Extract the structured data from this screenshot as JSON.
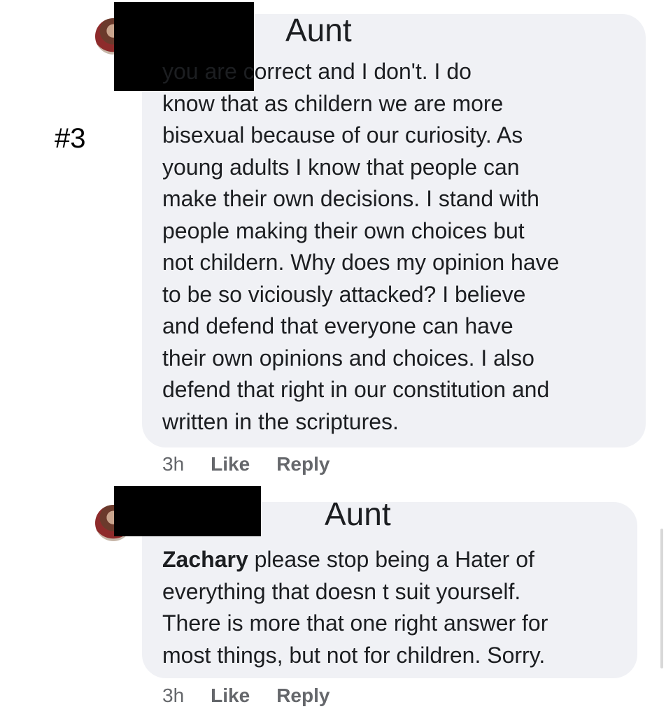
{
  "annotation": {
    "marker": "#3"
  },
  "comments": [
    {
      "author_label": "Aunt",
      "text": "you are correct and I don't. I do\nknow that as childern we are more\nbisexual because of our curiosity. As\nyoung adults I know that people can\nmake their own decisions. I stand with\npeople making their own choices but\nnot childern. Why does my opinion have\nto be so viciously attacked? I believe\nand defend that everyone can have\ntheir own opinions and choices. I also\ndefend that right in our constitution and\nwritten in the scriptures.",
      "time": "3h",
      "like_label": "Like",
      "reply_label": "Reply"
    },
    {
      "author_label": "Aunt",
      "mention": "Zachary",
      "text_after_mention": " please stop being a Hater of\neverything that doesn t suit yourself.\nThere is more that one right answer for\nmost things, but not for children. Sorry.",
      "time": "3h",
      "like_label": "Like",
      "reply_label": "Reply"
    }
  ]
}
